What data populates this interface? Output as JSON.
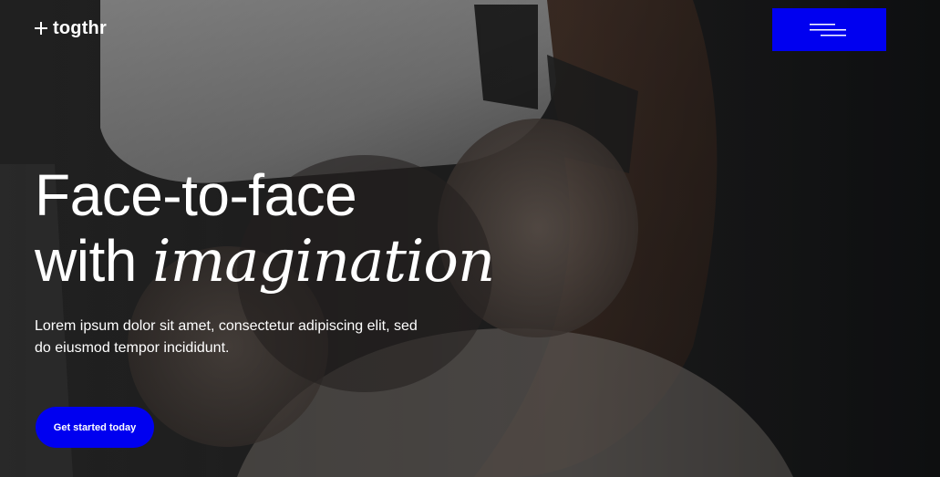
{
  "brand": {
    "name": "togthr",
    "logo_icon": "plus-arrow-logo-icon"
  },
  "header": {
    "menu_icon": "hamburger-menu-icon",
    "accent_color": "#0000f0"
  },
  "hero": {
    "headline_line1": "Face-to-face",
    "headline_line2_prefix": "with ",
    "headline_line2_emphasis": "imagination",
    "subtext": "Lorem ipsum dolor sit amet, consectetur adipiscing elit, sed do eiusmod tempor incididunt.",
    "cta_label": "Get started today",
    "background_image": "person-wearing-vr-headset-photo"
  }
}
